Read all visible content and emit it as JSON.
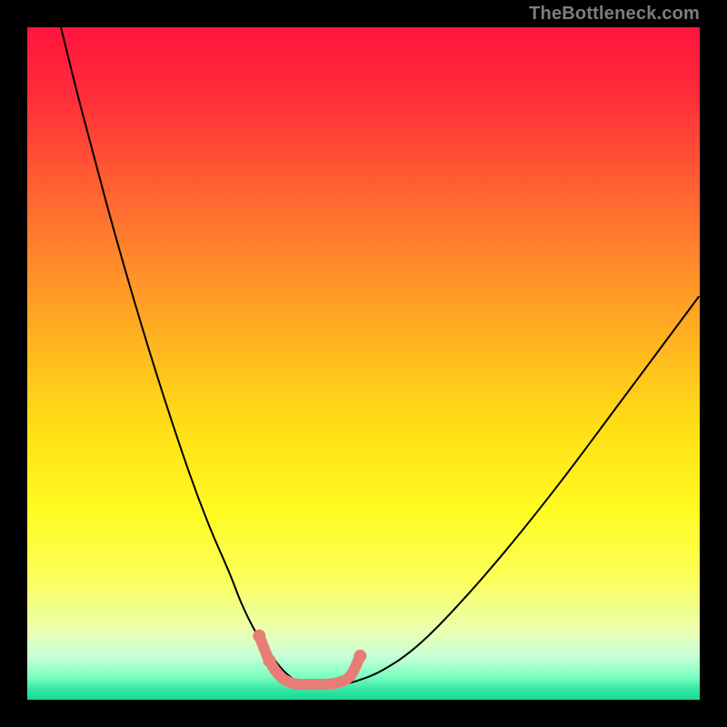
{
  "watermark": {
    "text": "TheBottleneck.com"
  },
  "gradient_stops": [
    {
      "offset": 0.0,
      "color": "#ff153e"
    },
    {
      "offset": 0.1,
      "color": "#ff2c3a"
    },
    {
      "offset": 0.22,
      "color": "#ff5a32"
    },
    {
      "offset": 0.35,
      "color": "#ff8a2a"
    },
    {
      "offset": 0.48,
      "color": "#ffb81f"
    },
    {
      "offset": 0.6,
      "color": "#ffe016"
    },
    {
      "offset": 0.72,
      "color": "#fffb22"
    },
    {
      "offset": 0.82,
      "color": "#fbff5a"
    },
    {
      "offset": 0.9,
      "color": "#e9ffb3"
    },
    {
      "offset": 0.935,
      "color": "#c7ffd6"
    },
    {
      "offset": 0.965,
      "color": "#7effc3"
    },
    {
      "offset": 0.985,
      "color": "#34e6a4"
    },
    {
      "offset": 1.0,
      "color": "#18d892"
    }
  ],
  "chart_data": {
    "type": "line",
    "title": "",
    "xlabel": "",
    "ylabel": "",
    "xlim": [
      0,
      100
    ],
    "ylim": [
      0,
      100
    ],
    "series": [
      {
        "name": "bottleneck-curve",
        "color": "#000000",
        "stroke_width": 2,
        "x": [
          5,
          8,
          12,
          16,
          20,
          24,
          27,
          30,
          32,
          34,
          36,
          37.5,
          39,
          40.5,
          43,
          46,
          49,
          53,
          58,
          64,
          71,
          79,
          88,
          99.9
        ],
        "y": [
          100,
          88,
          73,
          59,
          46,
          34,
          26,
          19,
          14,
          10,
          7,
          5,
          3.5,
          2.6,
          2.2,
          2.2,
          2.8,
          4.5,
          8,
          14,
          22,
          32,
          44,
          60
        ]
      },
      {
        "name": "optimal-zone-marker",
        "color": "#e87c77",
        "stroke_width": 12,
        "linecap": "round",
        "x": [
          34.5,
          36,
          37.5,
          39,
          40.5,
          42,
          44,
          46,
          48,
          49.5
        ],
        "y": [
          9.5,
          5.8,
          3.6,
          2.6,
          2.3,
          2.3,
          2.3,
          2.5,
          3.5,
          6.5
        ]
      }
    ],
    "markers": [
      {
        "series": "optimal-zone-marker",
        "x": 34.5,
        "y": 9.5,
        "r": 7,
        "color": "#e87c77"
      },
      {
        "series": "optimal-zone-marker",
        "x": 36.0,
        "y": 5.8,
        "r": 7,
        "color": "#e87c77"
      },
      {
        "series": "optimal-zone-marker",
        "x": 49.5,
        "y": 6.5,
        "r": 7,
        "color": "#e87c77"
      }
    ]
  }
}
